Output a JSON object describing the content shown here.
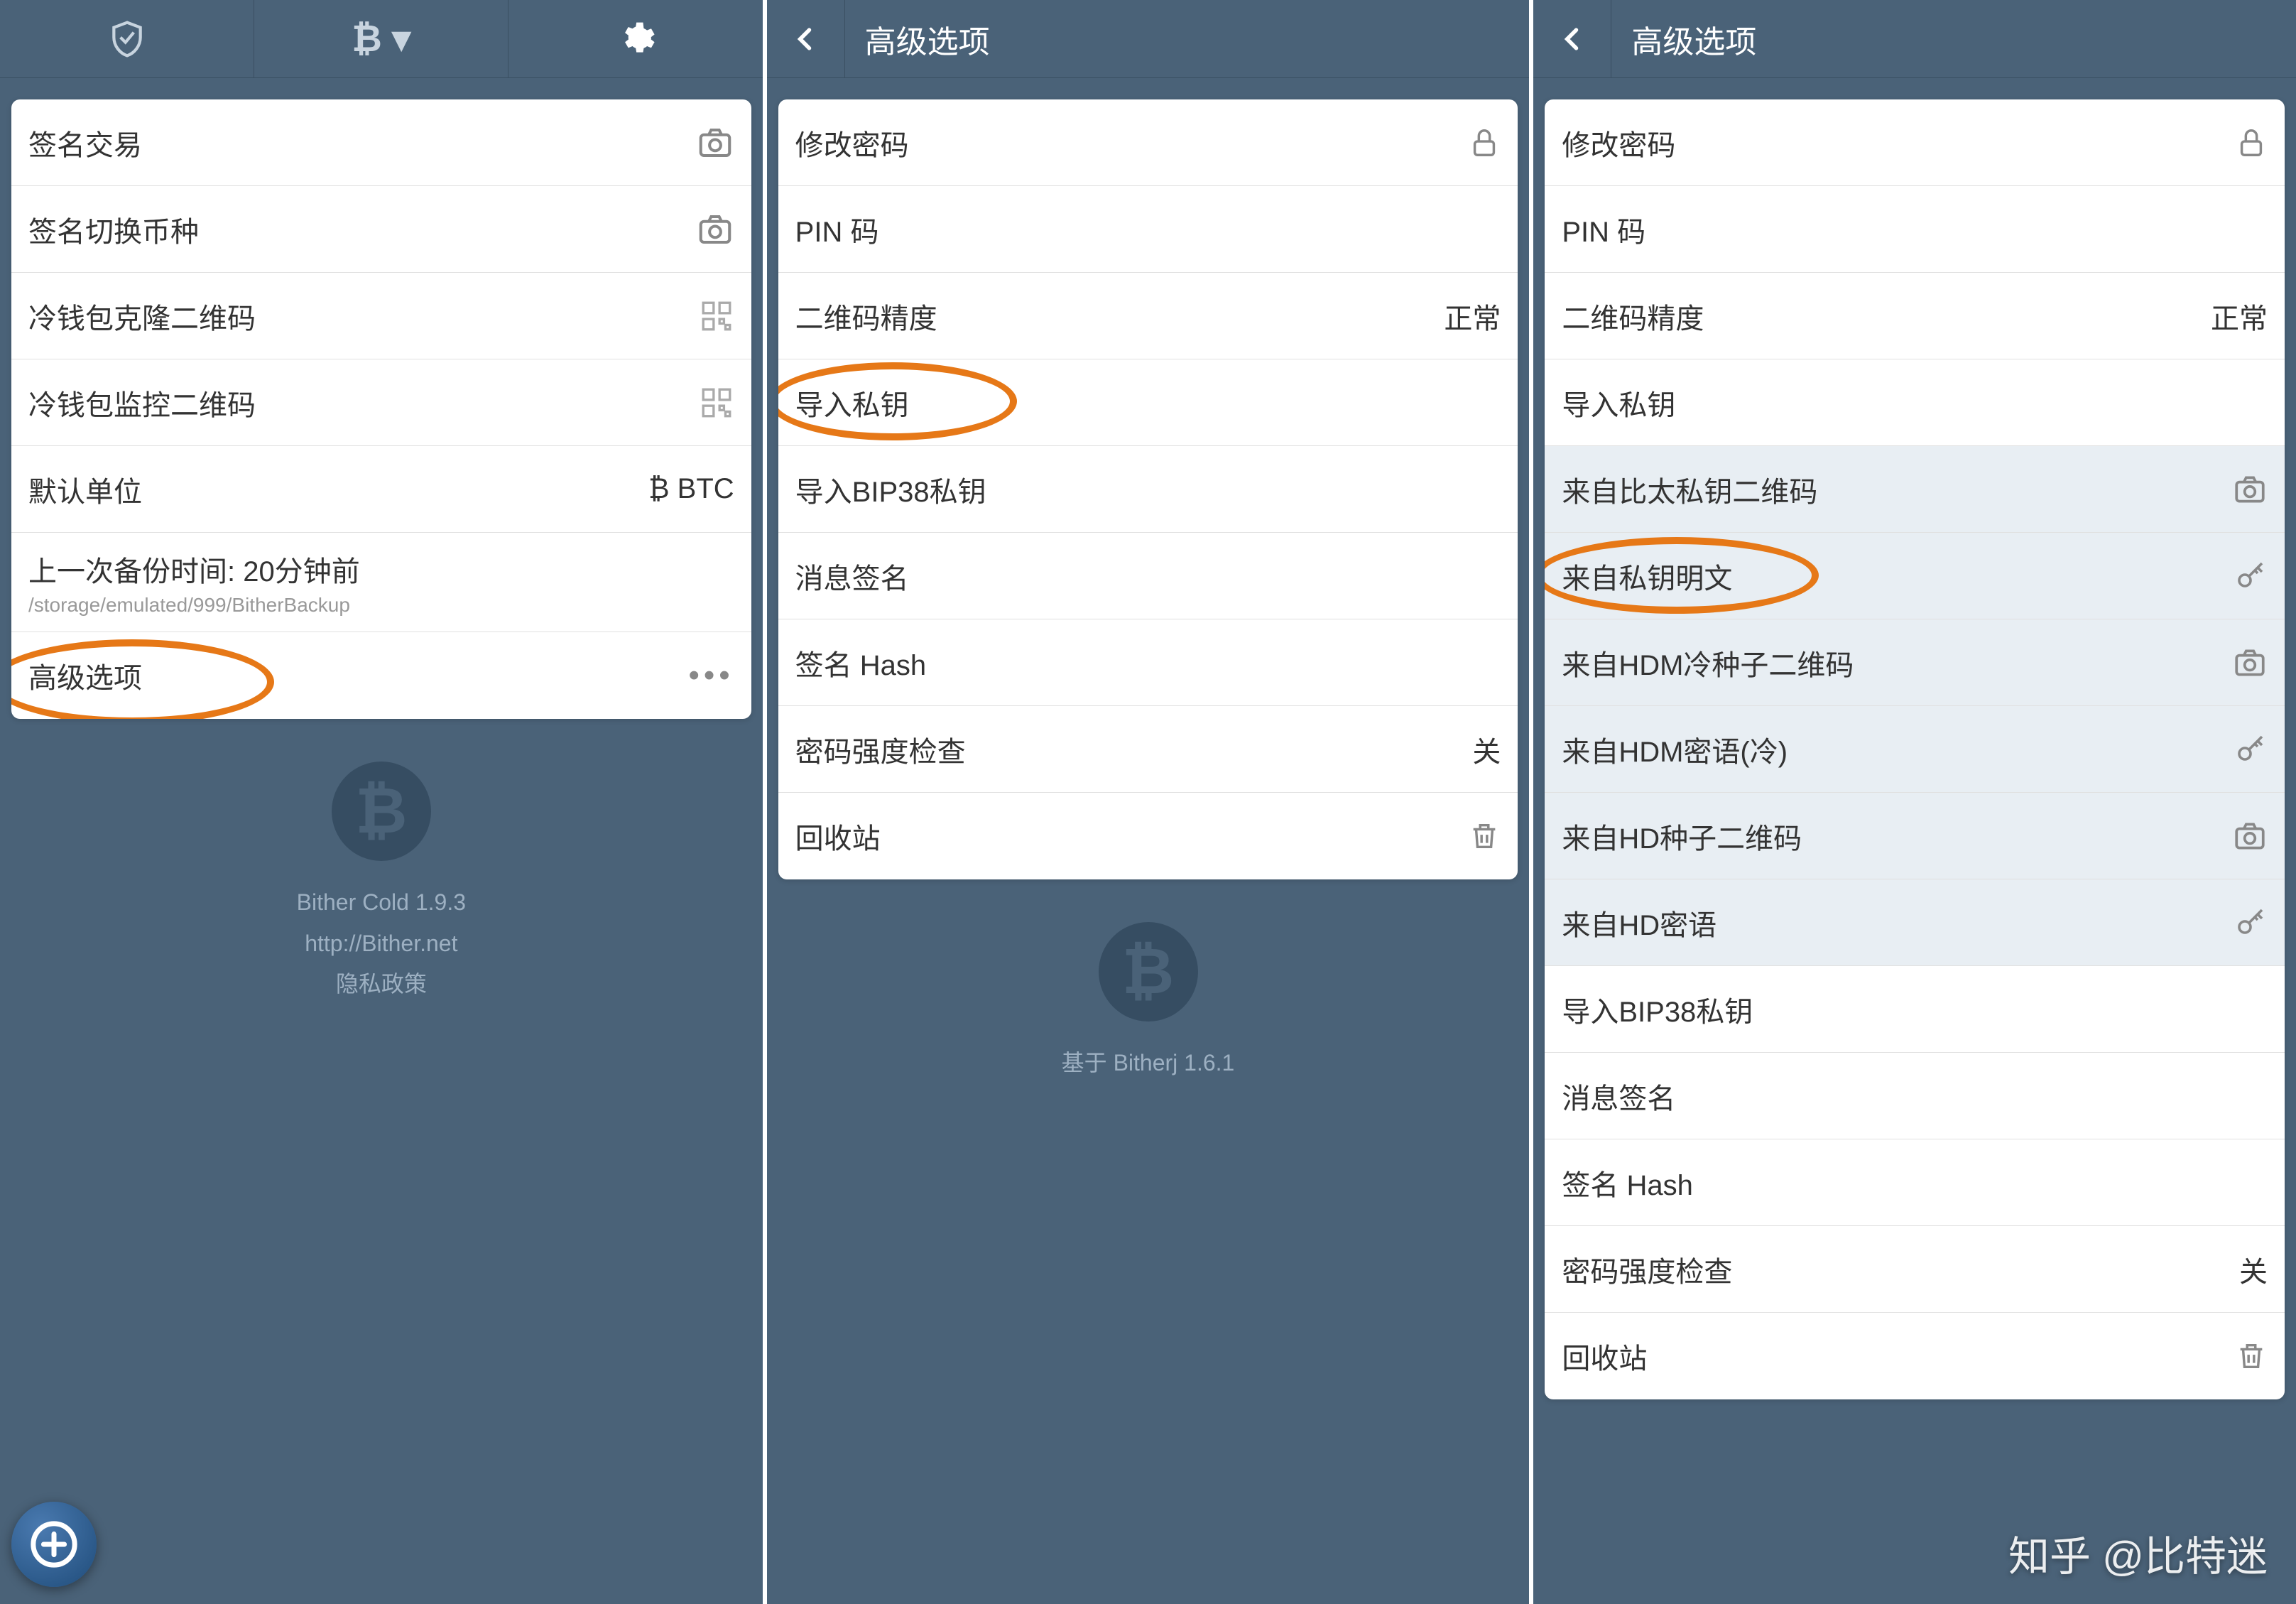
{
  "pane1": {
    "rows": [
      {
        "label": "签名交易",
        "icon": "camera"
      },
      {
        "label": "签名切换币种",
        "icon": "camera"
      },
      {
        "label": "冷钱包克隆二维码",
        "icon": "qr"
      },
      {
        "label": "冷钱包监控二维码",
        "icon": "qr"
      },
      {
        "label": "默认单位",
        "value": "₿ BTC"
      },
      {
        "label": "上一次备份时间: 20分钟前",
        "sub": "/storage/emulated/999/BitherBackup"
      },
      {
        "label": "高级选项",
        "icon": "more"
      }
    ],
    "footer": {
      "app": "Bither Cold 1.9.3",
      "url": "http://Bither.net",
      "privacy": "隐私政策"
    }
  },
  "pane2": {
    "title": "高级选项",
    "rows": [
      {
        "label": "修改密码",
        "icon": "lock"
      },
      {
        "label": "PIN 码"
      },
      {
        "label": "二维码精度",
        "value": "正常"
      },
      {
        "label": "导入私钥"
      },
      {
        "label": "导入BIP38私钥"
      },
      {
        "label": "消息签名"
      },
      {
        "label": "签名 Hash"
      },
      {
        "label": "密码强度检查",
        "value": "关"
      },
      {
        "label": "回收站",
        "icon": "trash"
      }
    ],
    "footer": {
      "based": "基于 Bitherj 1.6.1"
    }
  },
  "pane3": {
    "title": "高级选项",
    "rows": [
      {
        "label": "修改密码",
        "icon": "lock"
      },
      {
        "label": "PIN 码"
      },
      {
        "label": "二维码精度",
        "value": "正常"
      },
      {
        "label": "导入私钥"
      },
      {
        "label": "来自比太私钥二维码",
        "icon": "camera",
        "sub_row": true
      },
      {
        "label": "来自私钥明文",
        "icon": "key",
        "sub_row": true
      },
      {
        "label": "来自HDM冷种子二维码",
        "icon": "camera",
        "sub_row": true
      },
      {
        "label": "来自HDM密语(冷)",
        "icon": "key",
        "sub_row": true
      },
      {
        "label": "来自HD种子二维码",
        "icon": "camera",
        "sub_row": true
      },
      {
        "label": "来自HD密语",
        "icon": "key",
        "sub_row": true
      },
      {
        "label": "导入BIP38私钥"
      },
      {
        "label": "消息签名"
      },
      {
        "label": "签名 Hash"
      },
      {
        "label": "密码强度检查",
        "value": "关"
      },
      {
        "label": "回收站",
        "icon": "trash"
      }
    ]
  },
  "watermark": "知乎 @比特迷"
}
